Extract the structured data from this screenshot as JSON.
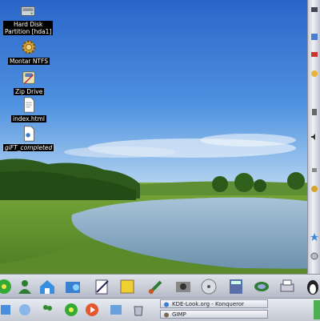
{
  "desktop": {
    "icons": [
      {
        "label": "Hard Disk\nPartition [hda1]",
        "icon": "hard-disk-icon"
      },
      {
        "label": "Montar NTFS",
        "icon": "gear-icon"
      },
      {
        "label": "Zip Drive",
        "icon": "zip-drive-icon"
      },
      {
        "label": "index.html",
        "icon": "html-file-icon"
      },
      {
        "label": "giFT_completed",
        "icon": "folder-document-icon"
      }
    ]
  },
  "taskbar": {
    "tasks": [
      {
        "label": "KDE-Look.org - Konqueror",
        "icon": "konqueror-icon"
      },
      {
        "label": "GIMP",
        "icon": "gimp-icon"
      }
    ]
  },
  "colors": {
    "sky_top": "#2f6fd0",
    "sky_bottom": "#a9cdef",
    "grass": "#5a8f2a",
    "water": "#8fb1c8",
    "panel": "#c8ccd6",
    "label_bg": "#000000"
  }
}
